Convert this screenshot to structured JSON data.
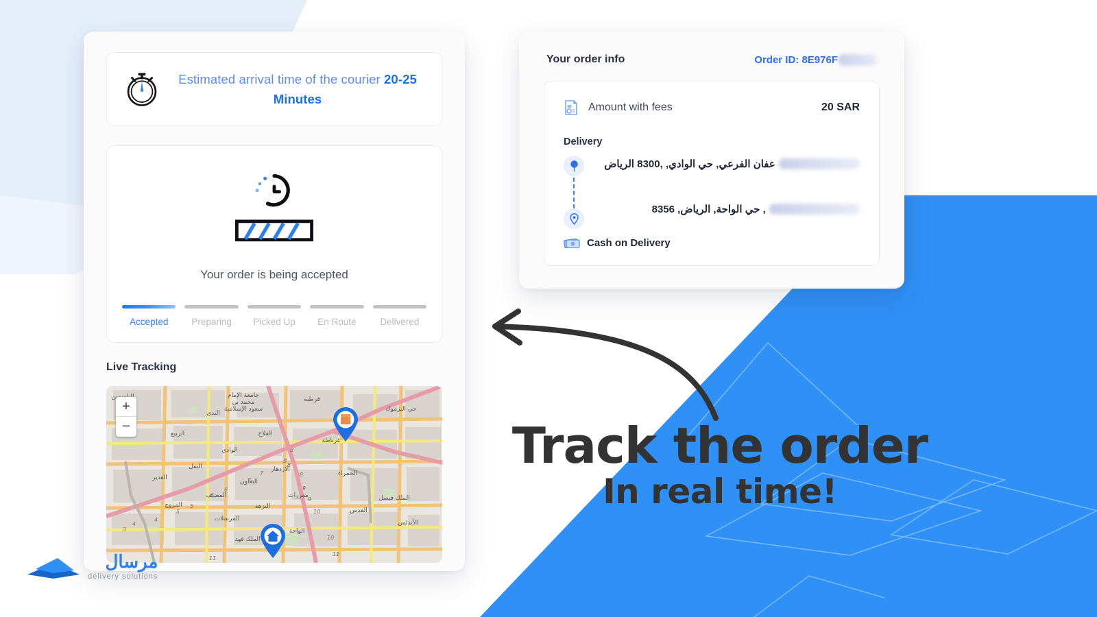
{
  "theme": {
    "brand_blue": "#2f90f5",
    "accent_blue": "#2f6ef0",
    "pale_blue": "#e6f0fb",
    "muted_grey": "#b9bbc1",
    "dark_text": "#333333"
  },
  "eta": {
    "icon": "stopwatch-icon",
    "prefix": "Estimated arrival time of the courier ",
    "value": "20-25 Minutes"
  },
  "status": {
    "spinner_icon": "clock-spinner-icon",
    "loading_icon": "loading-bar-icon",
    "message": "Your order is being accepted",
    "steps": [
      {
        "label": "Accepted",
        "active": true
      },
      {
        "label": "Preparing",
        "active": false
      },
      {
        "label": "Picked Up",
        "active": false
      },
      {
        "label": "En Route",
        "active": false
      },
      {
        "label": "Delivered",
        "active": false
      }
    ]
  },
  "live_tracking": {
    "title": "Live Tracking",
    "zoom_in": "+",
    "zoom_out": "−",
    "markers": [
      {
        "name": "store-marker",
        "type": "store"
      },
      {
        "name": "home-marker",
        "type": "home"
      }
    ],
    "map_labels": [
      "الياسمين",
      "جامعة الإمام محمد بن سعود الإسلامية",
      "قرطبة",
      "حي اليرموك",
      "الندى",
      "الربيع",
      "الفلاح",
      "غرناطة",
      "الوادي",
      "النفل",
      "الازدهار",
      "الحمراء",
      "الغدير",
      "التعاون",
      "المصيف",
      "مقررات",
      "الملك فيصل",
      "المروج",
      "النزهة",
      "القدس",
      "المرسلات",
      "الواحة",
      "الأندلس",
      "الملك فهد"
    ],
    "map_route_numbers": [
      "3",
      "4",
      "5",
      "6",
      "7",
      "8",
      "9",
      "10",
      "11"
    ]
  },
  "order_info": {
    "title": "Your order info",
    "order_id_label": "Order ID: 8E976F",
    "order_id_redacted": true,
    "fee": {
      "icon": "invoice-icon",
      "label": "Amount with fees",
      "amount": "20 SAR"
    },
    "delivery": {
      "label": "Delivery",
      "pickup": {
        "icon": "pin-filled-icon",
        "text": "عفان الفرعي, حي الوادي, ,8300 الرياض",
        "redacted": true
      },
      "dropoff": {
        "icon": "pin-outline-icon",
        "text": ", حي الواحة, الرياض, 8356",
        "redacted": true
      }
    },
    "payment": {
      "icon": "cash-icon",
      "label": "Cash on Delivery"
    }
  },
  "promo": {
    "arrow_icon": "curved-arrow-left-icon",
    "line1": "Track the order",
    "line2": "In real time!"
  },
  "logo": {
    "mark": "paper-boat-logo-icon",
    "name": "مرسال",
    "tagline": "delivery solutions"
  }
}
